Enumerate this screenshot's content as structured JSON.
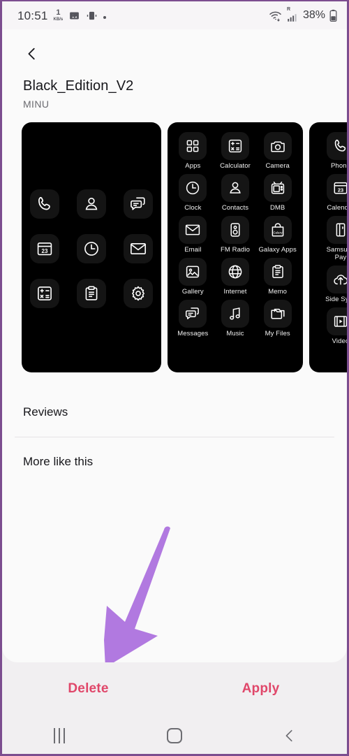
{
  "statusbar": {
    "time": "10:51",
    "net_speed_value": "1",
    "net_speed_unit": "KB/s",
    "screenshot_icon": "image-icon",
    "vibrate_icon": "vibrate-icon",
    "more_icon": "more-dot-icon",
    "wifi_icon": "wifi-icon",
    "signal_icon": "signal-bars-icon",
    "roaming_label": "R",
    "battery_percent": "38%",
    "battery_icon": "battery-icon"
  },
  "header": {
    "back_icon": "chevron-left-icon",
    "title": "Black_Edition_V2",
    "author": "MINU"
  },
  "previews": [
    {
      "id": "preview-card-1",
      "labels_visible": false,
      "icons": [
        {
          "name": "phone-icon",
          "label": "Phone"
        },
        {
          "name": "contacts-icon",
          "label": "Contacts"
        },
        {
          "name": "messages-icon",
          "label": "Messages"
        },
        {
          "name": "calendar-icon",
          "label": "Calendar",
          "day": "23"
        },
        {
          "name": "clock-icon",
          "label": "Clock"
        },
        {
          "name": "email-icon",
          "label": "Email"
        },
        {
          "name": "calculator-icon",
          "label": "Calculator"
        },
        {
          "name": "memo-icon",
          "label": "Memo"
        },
        {
          "name": "settings-icon",
          "label": "Settings"
        }
      ]
    },
    {
      "id": "preview-card-2",
      "labels_visible": true,
      "icons": [
        {
          "name": "apps-icon",
          "label": "Apps"
        },
        {
          "name": "calculator-icon",
          "label": "Calculator"
        },
        {
          "name": "camera-icon",
          "label": "Camera"
        },
        {
          "name": "clock-icon",
          "label": "Clock"
        },
        {
          "name": "contacts-icon",
          "label": "Contacts"
        },
        {
          "name": "dmb-icon",
          "label": "DMB"
        },
        {
          "name": "email-icon",
          "label": "Email"
        },
        {
          "name": "fm-radio-icon",
          "label": "FM Radio"
        },
        {
          "name": "galaxy-apps-icon",
          "label": "Galaxy Apps"
        },
        {
          "name": "gallery-icon",
          "label": "Gallery"
        },
        {
          "name": "internet-icon",
          "label": "Internet"
        },
        {
          "name": "memo-icon",
          "label": "Memo"
        },
        {
          "name": "messages-icon",
          "label": "Messages"
        },
        {
          "name": "music-icon",
          "label": "Music"
        },
        {
          "name": "my-files-icon",
          "label": "My Files"
        }
      ]
    },
    {
      "id": "preview-card-3",
      "labels_visible": true,
      "icons": [
        {
          "name": "phone-icon",
          "label": "Phone"
        },
        {
          "name": "calendar-icon",
          "label": "Calendar",
          "day": "23"
        },
        {
          "name": "samsung-pay-icon",
          "label": "Samsung Pay"
        },
        {
          "name": "side-sync-icon",
          "label": "Side Sync"
        },
        {
          "name": "video-icon",
          "label": "Video"
        }
      ]
    }
  ],
  "sections": [
    {
      "name": "reviews",
      "label": "Reviews"
    },
    {
      "name": "more-like-this",
      "label": "More like this"
    }
  ],
  "actions": {
    "delete_label": "Delete",
    "apply_label": "Apply",
    "accent_color": "#e0476a"
  },
  "annotation": {
    "arrow_color": "#b179e0",
    "points_to": "Delete"
  },
  "navbar": {
    "recents_icon": "recents-icon",
    "home_icon": "home-icon",
    "back_icon": "nav-back-icon"
  },
  "theme": {
    "page_border": "#7c4d8f",
    "content_bg": "#fafafa",
    "bar_bg": "#f1eff1",
    "preview_bg": "#000000"
  }
}
